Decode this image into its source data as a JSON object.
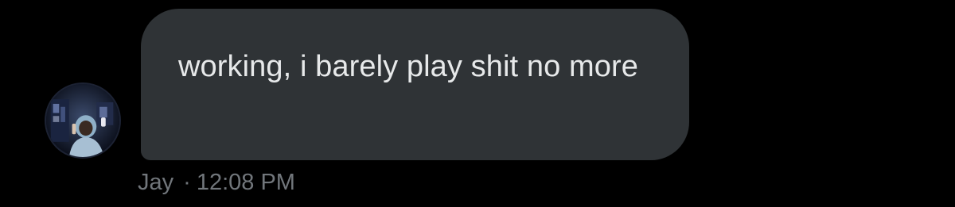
{
  "message": {
    "text": "working, i barely play shit no more",
    "sender": "Jay",
    "separator": "·",
    "timestamp": "12:08 PM",
    "avatar_icon": "user-avatar-photo"
  },
  "colors": {
    "background": "#000000",
    "bubble": "#2f3336",
    "text": "#e7e9ea",
    "meta": "#71767b"
  }
}
